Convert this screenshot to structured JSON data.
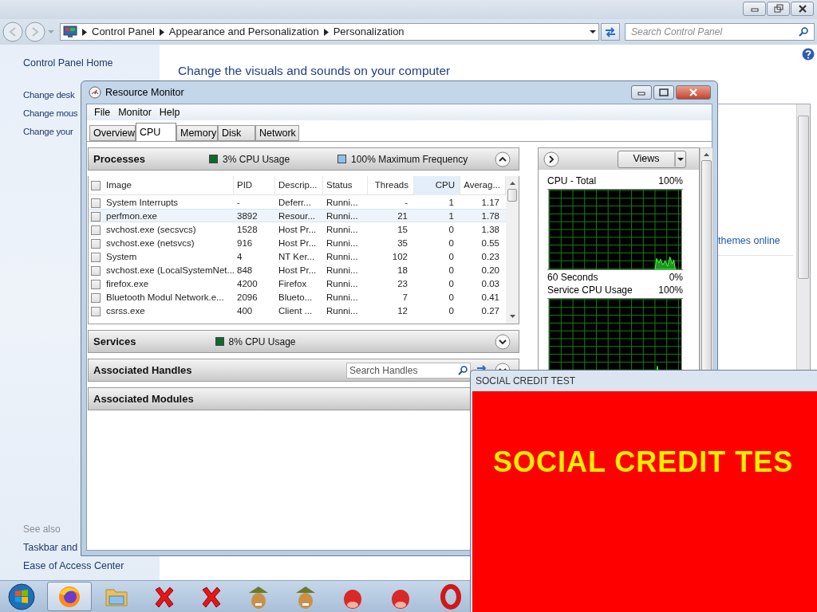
{
  "explorer": {
    "breadcrumbs": [
      "Control Panel",
      "Appearance and Personalization",
      "Personalization"
    ],
    "search_placeholder": "Search Control Panel",
    "sidebar_home": "Control Panel Home",
    "sidebar_links": [
      "Change desk",
      "Change mous",
      "Change your"
    ],
    "see_also_heading": "See also",
    "see_also": [
      "Taskbar and",
      "Ease of Access Center"
    ],
    "heading": "Change the visuals and sounds on your computer",
    "link": "themes online"
  },
  "resource_monitor": {
    "title": "Resource Monitor",
    "menu": [
      "File",
      "Monitor",
      "Help"
    ],
    "tabs": [
      {
        "label": "Overview",
        "selected": false
      },
      {
        "label": "CPU",
        "selected": true
      },
      {
        "label": "Memory",
        "selected": false
      },
      {
        "label": "Disk",
        "selected": false
      },
      {
        "label": "Network",
        "selected": false
      }
    ],
    "processes": {
      "title": "Processes",
      "all_checked": false,
      "cpu_usage": "3% CPU Usage",
      "frequency": "100% Maximum Frequency",
      "columns": [
        {
          "label": "Image",
          "sorted": false
        },
        {
          "label": "PID",
          "sorted": false
        },
        {
          "label": "Descrip...",
          "sorted": false
        },
        {
          "label": "Status",
          "sorted": false
        },
        {
          "label": "Threads",
          "sorted": false
        },
        {
          "label": "CPU",
          "sorted": true
        },
        {
          "label": "Averag...",
          "sorted": false
        }
      ],
      "rows": [
        {
          "checked": false,
          "hovered": false,
          "cells": [
            "System Interrupts",
            "-",
            "Deferr...",
            "Runni...",
            "-",
            "1",
            "1.17"
          ]
        },
        {
          "checked": false,
          "hovered": true,
          "cells": [
            "perfmon.exe",
            "3892",
            "Resour...",
            "Runni...",
            "21",
            "1",
            "1.78"
          ]
        },
        {
          "checked": false,
          "hovered": false,
          "cells": [
            "svchost.exe (secsvcs)",
            "1528",
            "Host Pr...",
            "Runni...",
            "15",
            "0",
            "1.38"
          ]
        },
        {
          "checked": false,
          "hovered": false,
          "cells": [
            "svchost.exe (netsvcs)",
            "916",
            "Host Pr...",
            "Runni...",
            "35",
            "0",
            "0.55"
          ]
        },
        {
          "checked": false,
          "hovered": false,
          "cells": [
            "System",
            "4",
            "NT Ker...",
            "Runni...",
            "102",
            "0",
            "0.23"
          ]
        },
        {
          "checked": false,
          "hovered": false,
          "cells": [
            "svchost.exe (LocalSystemNet...",
            "848",
            "Host Pr...",
            "Runni...",
            "18",
            "0",
            "0.20"
          ]
        },
        {
          "checked": false,
          "hovered": false,
          "cells": [
            "firefox.exe",
            "4200",
            "Firefox",
            "Runni...",
            "23",
            "0",
            "0.03"
          ]
        },
        {
          "checked": false,
          "hovered": false,
          "cells": [
            "Bluetooth Modul Network.e...",
            "2096",
            "Blueto...",
            "Runni...",
            "7",
            "0",
            "0.41"
          ]
        },
        {
          "checked": false,
          "hovered": false,
          "cells": [
            "csrss.exe",
            "400",
            "Client ...",
            "Runni...",
            "12",
            "0",
            "0.27"
          ]
        }
      ]
    },
    "services": {
      "title": "Services",
      "cpu_usage": "8% CPU Usage"
    },
    "handles": {
      "title": "Associated Handles",
      "search_placeholder": "Search Handles"
    },
    "modules": {
      "title": "Associated Modules"
    },
    "views_button": "Views",
    "graphs": [
      {
        "title": "CPU - Total",
        "max": "100%",
        "time": "60 Seconds",
        "min": "0%"
      },
      {
        "title": "Service CPU Usage",
        "max": "100%"
      }
    ]
  },
  "popup": {
    "title": "SOCIAL CREDIT TEST",
    "text": "SOCIAL CREDIT TES"
  },
  "taskbar": [
    {
      "kind": "browser",
      "selected": true
    },
    {
      "kind": "folder",
      "selected": false
    },
    {
      "kind": "cross",
      "selected": false
    },
    {
      "kind": "cross",
      "selected": false
    },
    {
      "kind": "hat",
      "selected": false
    },
    {
      "kind": "hat",
      "selected": false
    },
    {
      "kind": "bird",
      "selected": false
    },
    {
      "kind": "bird",
      "selected": false
    },
    {
      "kind": "ring",
      "selected": false
    }
  ]
}
